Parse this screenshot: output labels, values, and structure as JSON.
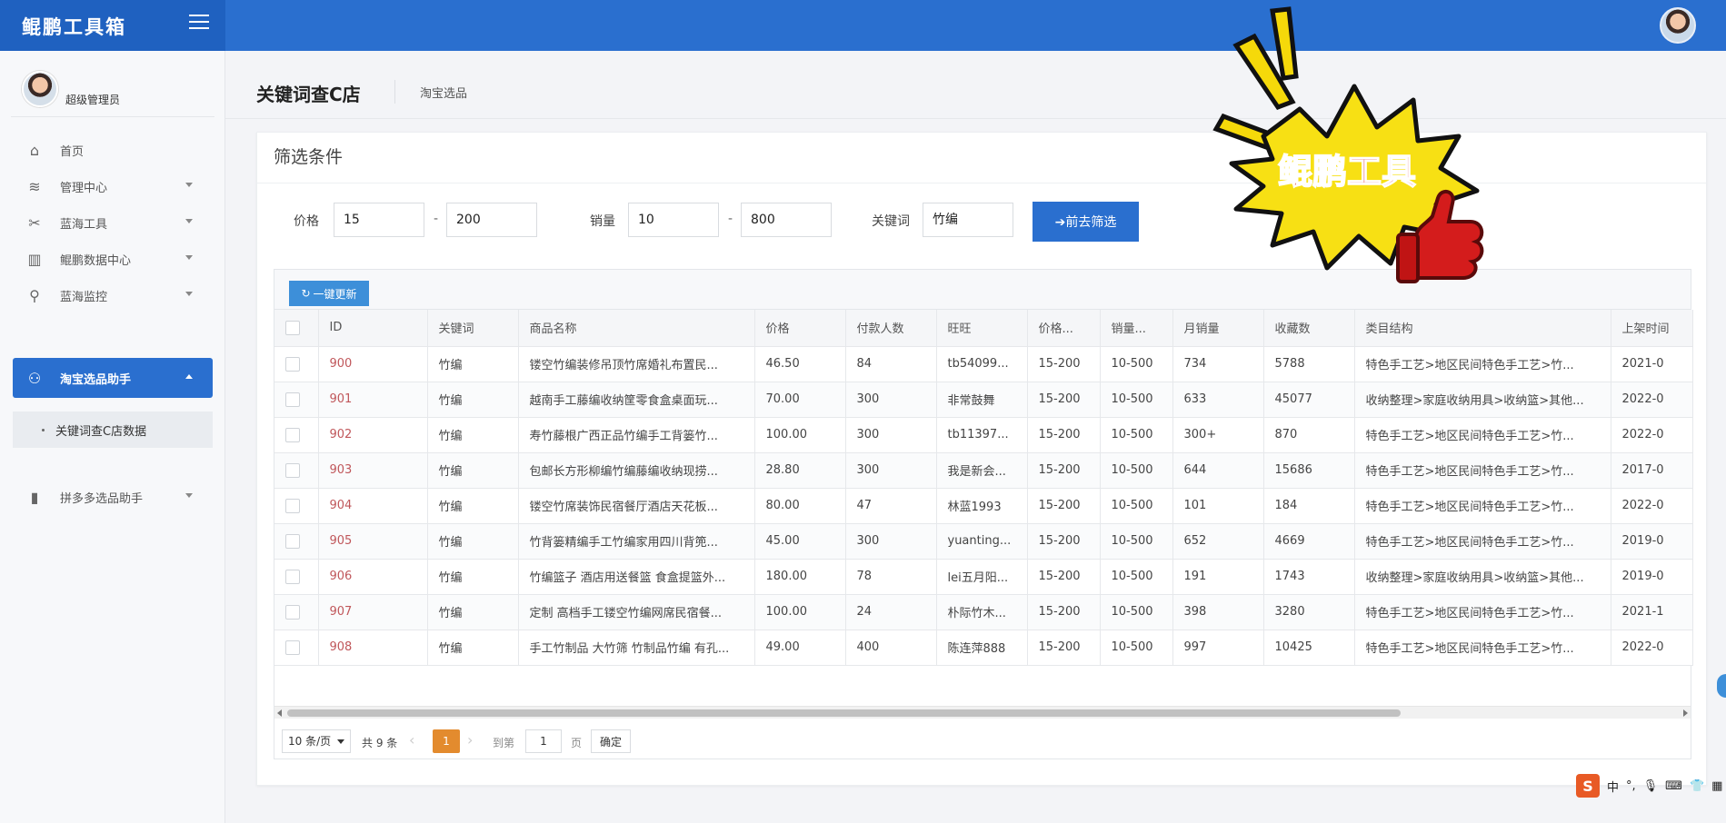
{
  "app": {
    "brand": "鲲鹏工具箱"
  },
  "user": {
    "name": "超级管理员"
  },
  "sidebar": {
    "items": [
      {
        "label": "首页",
        "icon": "home-icon"
      },
      {
        "label": "管理中心",
        "icon": "layers-icon"
      },
      {
        "label": "蓝海工具",
        "icon": "tools-icon"
      },
      {
        "label": "鲲鹏数据中心",
        "icon": "chart-icon"
      },
      {
        "label": "蓝海监控",
        "icon": "search-icon"
      },
      {
        "label": "淘宝选品助手",
        "icon": "user-star-icon"
      },
      {
        "label": "拼多多选品助手",
        "icon": "phone-icon"
      }
    ],
    "sub_items": [
      {
        "label": "关键词查C店数据"
      }
    ]
  },
  "page": {
    "title": "关键词查C店",
    "breadcrumb": "淘宝选品"
  },
  "filter": {
    "title": "筛选条件",
    "price_label": "价格",
    "price_min": "15",
    "price_max": "200",
    "sales_label": "销量",
    "sales_min": "10",
    "sales_max": "800",
    "keyword_label": "关键词",
    "keyword_value": "竹编",
    "range_sep": "-",
    "submit_label": "➔前去筛选"
  },
  "toolbar": {
    "refresh_label": "一键更新"
  },
  "table": {
    "headers": [
      "ID",
      "关键词",
      "商品名称",
      "价格",
      "付款人数",
      "旺旺",
      "价格...",
      "销量...",
      "月销量",
      "收藏数",
      "类目结构",
      "上架时间"
    ],
    "rows": [
      [
        "900",
        "竹编",
        "镂空竹编装修吊顶竹席婚礼布置民...",
        "46.50",
        "84",
        "tb54099...",
        "15-200",
        "10-500",
        "734",
        "5788",
        "特色手工艺>地区民间特色手工艺>竹...",
        "2021-0"
      ],
      [
        "901",
        "竹编",
        "越南手工藤编收纳筐零食盒桌面玩...",
        "70.00",
        "300",
        "非常鼓舞",
        "15-200",
        "10-500",
        "633",
        "45077",
        "收纳整理>家庭收纳用具>收纳篮>其他...",
        "2022-0"
      ],
      [
        "902",
        "竹编",
        "寿竹藤根广西正品竹编手工背篓竹...",
        "100.00",
        "300",
        "tb11397...",
        "15-200",
        "10-500",
        "300+",
        "870",
        "特色手工艺>地区民间特色手工艺>竹...",
        "2022-0"
      ],
      [
        "903",
        "竹编",
        "包邮长方形柳编竹编藤编收纳现捞...",
        "28.80",
        "300",
        "我是新会...",
        "15-200",
        "10-500",
        "644",
        "15686",
        "特色手工艺>地区民间特色手工艺>竹...",
        "2017-0"
      ],
      [
        "904",
        "竹编",
        "镂空竹席装饰民宿餐厅酒店天花板...",
        "80.00",
        "47",
        "林蓝1993",
        "15-200",
        "10-500",
        "101",
        "184",
        "特色手工艺>地区民间特色手工艺>竹...",
        "2022-0"
      ],
      [
        "905",
        "竹编",
        "竹背篓精编手工竹编家用四川背篼...",
        "45.00",
        "300",
        "yuanting...",
        "15-200",
        "10-500",
        "652",
        "4669",
        "特色手工艺>地区民间特色手工艺>竹...",
        "2019-0"
      ],
      [
        "906",
        "竹编",
        "竹编篮子 酒店用送餐篮 食盒提篮外...",
        "180.00",
        "78",
        "lei五月阳...",
        "15-200",
        "10-500",
        "191",
        "1743",
        "收纳整理>家庭收纳用具>收纳篮>其他...",
        "2019-0"
      ],
      [
        "907",
        "竹编",
        "定制 高档手工镂空竹编网席民宿餐...",
        "100.00",
        "24",
        "朴际竹木...",
        "15-200",
        "10-500",
        "398",
        "3280",
        "特色手工艺>地区民间特色手工艺>竹...",
        "2021-1"
      ],
      [
        "908",
        "竹编",
        "手工竹制品 大竹筛 竹制品竹编 有孔...",
        "49.00",
        "400",
        "陈连萍888",
        "15-200",
        "10-500",
        "997",
        "10425",
        "特色手工艺>地区民间特色手工艺>竹...",
        "2022-0"
      ]
    ]
  },
  "pagination": {
    "page_size": "10 条/页",
    "total": "共 9 条",
    "current_page": "1",
    "goto_label": "到第",
    "goto_value": "1",
    "page_unit": "页",
    "confirm_label": "确定"
  },
  "promo": {
    "text": "鲲鹏工具"
  },
  "ime": {
    "mode": "中",
    "punct": "°,"
  },
  "colors": {
    "primary": "#2a6fcf",
    "accent": "#e38b2e",
    "id_text": "#c0575b"
  }
}
